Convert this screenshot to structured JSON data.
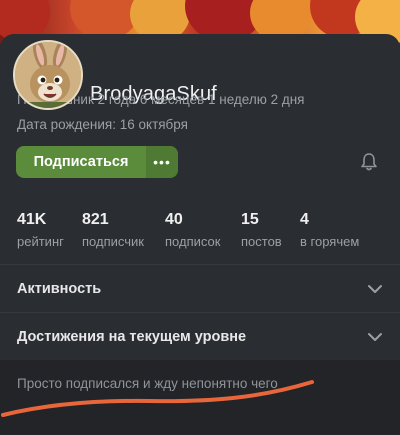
{
  "profile": {
    "username": "BrodyagaSkuf",
    "member_since": "Пикабушник 2 года 6 месяцев 1 неделю 2 дня",
    "birthday": "Дата рождения: 16 октября"
  },
  "actions": {
    "subscribe_label": "Подписаться",
    "more_label": "•••"
  },
  "stats": [
    {
      "value": "41K",
      "label": "рейтинг"
    },
    {
      "value": "821",
      "label": "подписчик"
    },
    {
      "value": "40",
      "label": "подписок"
    },
    {
      "value": "15",
      "label": "постов"
    },
    {
      "value": "4",
      "label": "в горячем"
    }
  ],
  "sections": {
    "activity": "Активность",
    "achievements": "Достижения на текущем уровне"
  },
  "bio": {
    "text": "Просто подписался и жду непонятно чего"
  },
  "icons": {
    "bell": "bell-icon",
    "chevron": "chevron-down-icon",
    "more": "more-dots-icon"
  },
  "colors": {
    "subscribe_bg": "#5b8c3b",
    "background": "#2a2d31",
    "scribble": "#e8663a"
  }
}
